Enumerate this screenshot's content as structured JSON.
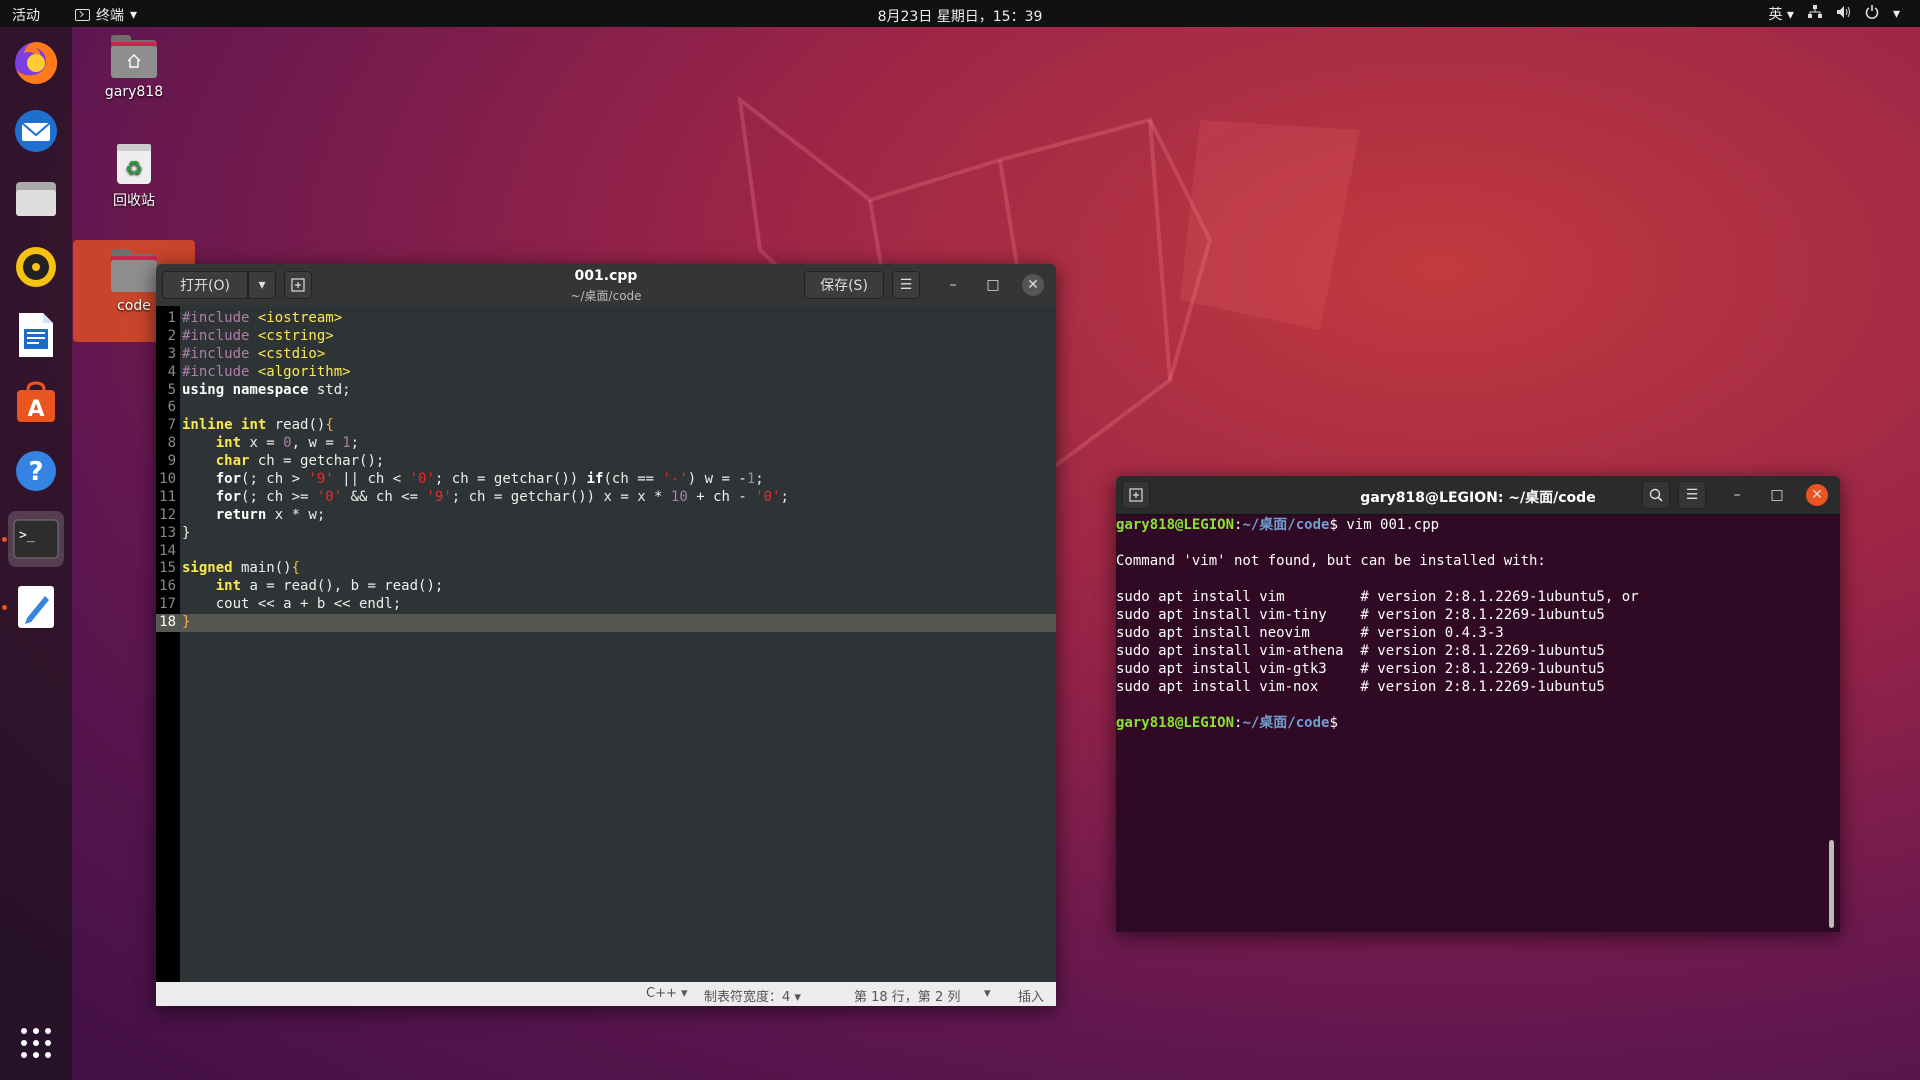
{
  "topbar": {
    "activities": "活动",
    "app_name": "终端",
    "clock": "8月23日 星期日，15：39",
    "input_method": "英"
  },
  "desktop": {
    "icons": [
      {
        "label": "gary818",
        "icon": "home-folder-icon"
      },
      {
        "label": "回收站",
        "icon": "trash-icon"
      },
      {
        "label": "code",
        "icon": "folder-icon"
      }
    ]
  },
  "dock": {
    "items": [
      "firefox-icon",
      "thunderbird-icon",
      "files-icon",
      "rhythmbox-icon",
      "libreoffice-writer-icon",
      "software-icon",
      "help-icon",
      "terminal-icon",
      "text-editor-icon"
    ],
    "show_apps": "show-apps-icon"
  },
  "gedit": {
    "open_label": "打开(O)",
    "save_label": "保存(S)",
    "title": "001.cpp",
    "subtitle": "~/桌面/code",
    "lines": [
      "#include <iostream>",
      "#include <cstring>",
      "#include <cstdio>",
      "#include <algorithm>",
      "using namespace std;",
      "",
      "inline int read(){",
      "    int x = 0, w = 1;",
      "    char ch = getchar();",
      "    for(; ch > '9' || ch < '0'; ch = getchar()) if(ch == '-') w = -1;",
      "    for(; ch >= '0' && ch <= '9'; ch = getchar()) x = x * 10 + ch - '0';",
      "    return x * w;",
      "}",
      "",
      "signed main(){",
      "    int a = read(), b = read();",
      "    cout << a + b << endl;",
      "}"
    ],
    "line_numbers": [
      "1",
      "2",
      "3",
      "4",
      "5",
      "6",
      "7",
      "8",
      "9",
      "10",
      "11",
      "12",
      "13",
      "14",
      "15",
      "16",
      "17",
      "18"
    ],
    "current_line": 18,
    "status": {
      "language": "C++ ▾",
      "tab_width": "制表符宽度：4 ▾",
      "position": "第 18 行，第 2 列",
      "mode": "插入"
    }
  },
  "terminal": {
    "title": "gary818@LEGION: ~/桌面/code",
    "prompt_user": "gary818@LEGION",
    "prompt_path": "~/桌面/code",
    "command": " vim 001.cpp",
    "output": [
      "",
      "Command 'vim' not found, but can be installed with:",
      "",
      "sudo apt install vim         # version 2:8.1.2269-1ubuntu5, or",
      "sudo apt install vim-tiny    # version 2:8.1.2269-1ubuntu5",
      "sudo apt install neovim      # version 0.4.3-3",
      "sudo apt install vim-athena  # version 2:8.1.2269-1ubuntu5",
      "sudo apt install vim-gtk3    # version 2:8.1.2269-1ubuntu5",
      "sudo apt install vim-nox     # version 2:8.1.2269-1ubuntu5",
      ""
    ]
  }
}
